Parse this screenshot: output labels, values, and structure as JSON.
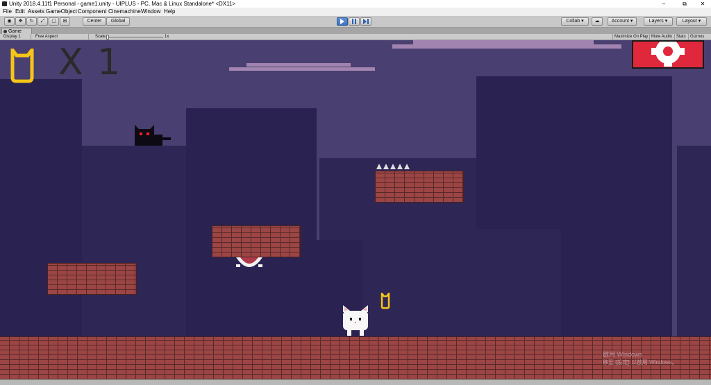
{
  "window": {
    "title": "Unity 2018.4.11f1 Personal - game1.unity - UIPLUS - PC, Mac & Linux Standalone* <DX11>",
    "minimize": "–",
    "maximize": "⧉",
    "close": "✕"
  },
  "menu": [
    "File",
    "Edit",
    "Assets",
    "GameObject",
    "Component",
    "Cinemachine",
    "Window",
    "Help"
  ],
  "toolbar": {
    "pivot": "Center",
    "space": "Global",
    "play_icon": "play-icon",
    "pause_icon": "pause-icon",
    "step_icon": "step-icon",
    "collab": "Collab ▾",
    "account": "Account ▾",
    "layers": "Layers ▾",
    "layout": "Layout ▾"
  },
  "game_tab": {
    "label": "Game",
    "display": "Display 1",
    "aspect": "Free Aspect",
    "scale_label": "Scale",
    "scale_value": "1x",
    "maximize_on_play": "Maximize On Play",
    "mute_audio": "Mute Audio",
    "stats": "Stats",
    "gizmos": "Gizmos"
  },
  "hud": {
    "lives_text": "X 1",
    "item_icon": "cat-ear-token-icon"
  },
  "watermark": {
    "line1": "啟用 Windows",
    "line2": "移至 [設定] 以啟用 Windows。"
  },
  "colors": {
    "sky": "#493f70",
    "building": "#2a2352",
    "brick": "#9b4545",
    "cloud": "#a185b0",
    "token": "#f5c518",
    "accent_red": "#e0283c"
  }
}
